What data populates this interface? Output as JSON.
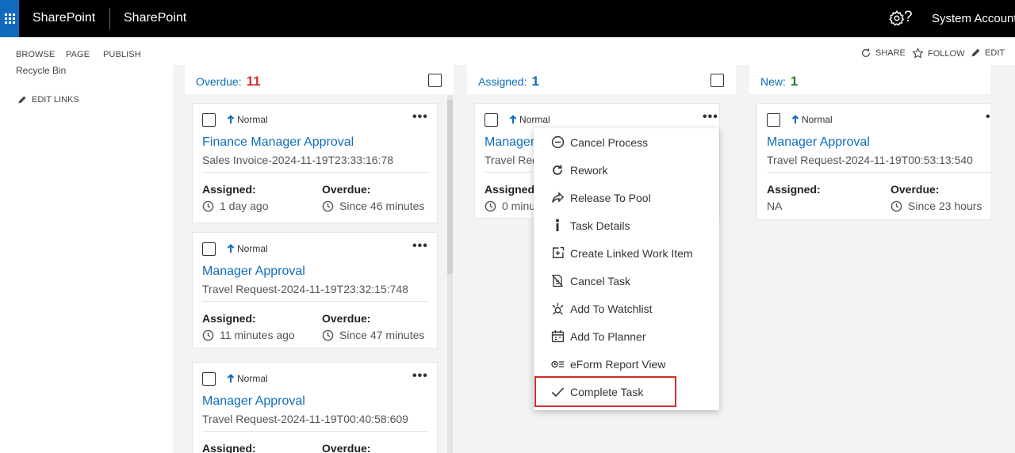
{
  "suitebar": {
    "brand": "SharePoint",
    "site_title": "SharePoint",
    "help": "?",
    "account": "System Account"
  },
  "ribbon": {
    "tabs": [
      "BROWSE",
      "PAGE",
      "PUBLISH"
    ],
    "share": "SHARE",
    "follow": "FOLLOW",
    "edit": "EDIT"
  },
  "leftnav": {
    "recycle_bin": "Recycle Bin",
    "edit_links": "EDIT LINKS"
  },
  "columns": [
    {
      "label": "Overdue:",
      "count": "11",
      "count_color": "#d32f2f",
      "cards": [
        {
          "priority": "Normal",
          "title": "Finance Manager Approval",
          "subtitle": "Sales Invoice-2024-11-19T23:33:16:78",
          "assigned_label": "Assigned:",
          "assigned_value": "1 day ago",
          "overdue_label": "Overdue:",
          "overdue_value": "Since 46 minutes"
        },
        {
          "priority": "Normal",
          "title": "Manager Approval",
          "subtitle": "Travel Request-2024-11-19T23:32:15:748",
          "assigned_label": "Assigned:",
          "assigned_value": "11 minutes ago",
          "overdue_label": "Overdue:",
          "overdue_value": "Since 47 minutes"
        },
        {
          "priority": "Normal",
          "title": "Manager Approval",
          "subtitle": "Travel Request-2024-11-19T00:40:58:609",
          "assigned_label": "Assigned:",
          "overdue_label": "Overdue:"
        }
      ]
    },
    {
      "label": "Assigned:",
      "count": "1",
      "count_color": "#0f6cbd",
      "cards": [
        {
          "priority": "Normal",
          "title": "Manager",
          "subtitle": "Travel Req",
          "assigned_label": "Assigned:",
          "assigned_value": "0 minu"
        }
      ]
    },
    {
      "label": "New:",
      "count": "1",
      "count_color": "#2e7d32",
      "cards": [
        {
          "priority": "Normal",
          "title": "Manager Approval",
          "subtitle": "Travel Request-2024-11-19T00:53:13:540",
          "assigned_label": "Assigned:",
          "assigned_value": "NA",
          "overdue_label": "Overdue:",
          "overdue_value": "Since 23 hours"
        }
      ]
    }
  ],
  "context_menu": {
    "items": [
      {
        "label": "Cancel Process",
        "icon": "minus-circle-icon"
      },
      {
        "label": "Rework",
        "icon": "redo-icon"
      },
      {
        "label": "Release To Pool",
        "icon": "share-arrow-icon"
      },
      {
        "label": "Task Details",
        "icon": "info-icon"
      },
      {
        "label": "Create Linked Work Item",
        "icon": "linked-add-icon"
      },
      {
        "label": "Cancel Task",
        "icon": "cancel-doc-icon"
      },
      {
        "label": "Add To Watchlist",
        "icon": "watch-icon"
      },
      {
        "label": "Add To Planner",
        "icon": "calendar-icon"
      },
      {
        "label": "eForm Report View",
        "icon": "report-view-icon"
      },
      {
        "label": "Complete Task",
        "icon": "checkmark-icon"
      }
    ]
  },
  "colors": {
    "accent": "#0f6cbd",
    "highlight": "#d32f2f"
  }
}
